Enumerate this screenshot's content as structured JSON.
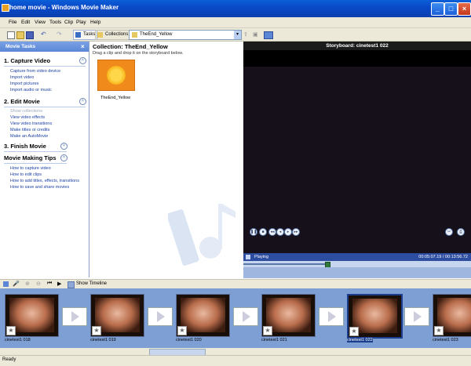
{
  "window": {
    "title": "home movie - Windows Movie Maker"
  },
  "menu": [
    "File",
    "Edit",
    "View",
    "Tools",
    "Clip",
    "Play",
    "Help"
  ],
  "toolbar": {
    "tasks_label": "Tasks",
    "collections_label": "Collections",
    "collection_select": "TheEnd_Yellow"
  },
  "tasks": {
    "header": "Movie Tasks",
    "sections": [
      {
        "title": "1. Capture Video",
        "links": [
          "Capture from video device",
          "Import video",
          "Import pictures",
          "Import audio or music"
        ]
      },
      {
        "title": "2. Edit Movie",
        "links": [
          "Show collections",
          "View video effects",
          "View video transitions",
          "Make titles or credits",
          "Make an AutoMovie"
        ]
      },
      {
        "title": "3. Finish Movie",
        "links": []
      },
      {
        "title": "Movie Making Tips",
        "links": [
          "How to capture video",
          "How to edit clips",
          "How to add titles, effects, transitions",
          "How to save and share movies"
        ]
      }
    ]
  },
  "collection": {
    "title": "Collection: TheEnd_Yellow",
    "hint": "Drag a clip and drop it on the storyboard below.",
    "items": [
      {
        "name": "TheEnd_Yellow"
      }
    ]
  },
  "preview": {
    "title": "Storyboard: cinetest1 022",
    "status": "Playing",
    "time": "00:05:07.19 / 00:13:56.72",
    "progress": 0.37
  },
  "storyboard": {
    "show_timeline_label": "Show Timeline",
    "clips": [
      "cinetest1 018",
      "cinetest1 019",
      "cinetest1 020",
      "cinetest1 021",
      "cinetest1 022",
      "cinetest1 023"
    ],
    "selected_index": 4
  },
  "statusbar": {
    "text": "Ready"
  },
  "colors": {
    "titlebar": "#0a49c8",
    "taskpane": "#ffffff",
    "link": "#1a3fa5",
    "storyboard": "#7e9fd4"
  }
}
